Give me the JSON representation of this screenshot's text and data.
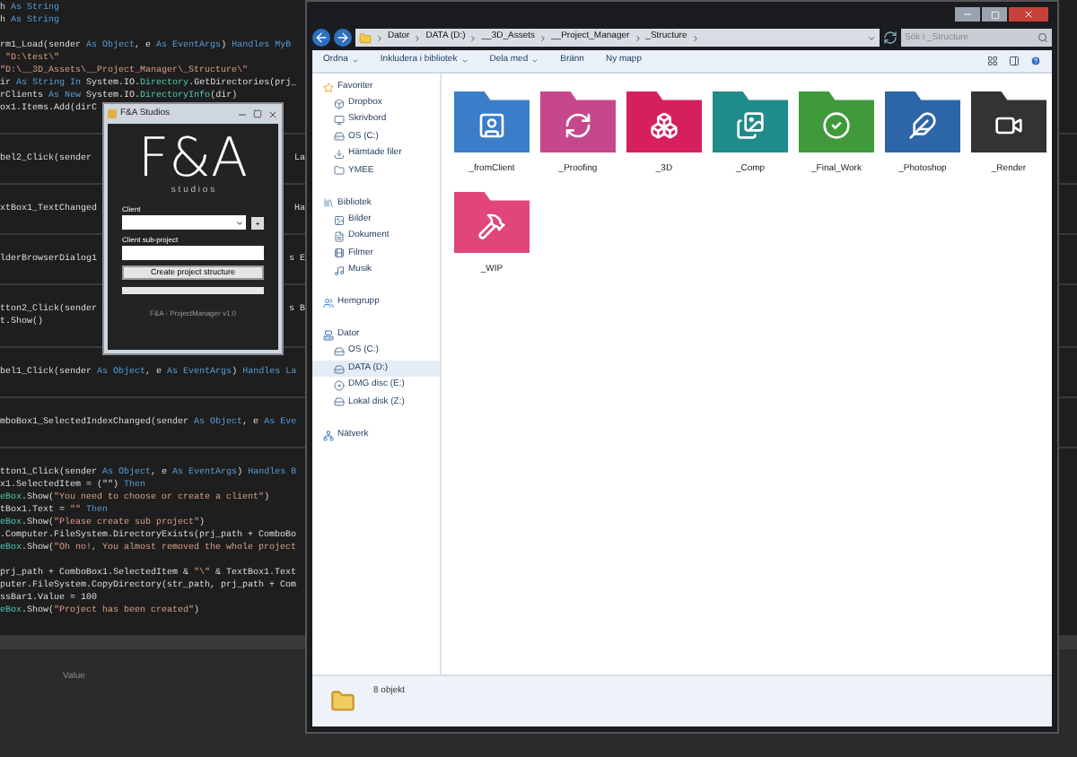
{
  "code_editor": {
    "blocks": [
      {
        "paragraphs": [
          [
            {
              "parts": [
                {
                  "text": "h ",
                  "kind": "plain"
                },
                {
                  "text": "As String",
                  "kind": "keyword"
                }
              ]
            },
            {
              "parts": [
                {
                  "text": "h ",
                  "kind": "plain"
                },
                {
                  "text": "As String",
                  "kind": "keyword"
                }
              ]
            }
          ],
          [
            {
              "parts": [
                {
                  "text": "rm1_Load(sender ",
                  "kind": "plain"
                },
                {
                  "text": "As Object",
                  "kind": "keyword"
                },
                {
                  "text": ", e ",
                  "kind": "plain"
                },
                {
                  "text": "As EventArgs",
                  "kind": "keyword"
                },
                {
                  "text": ") ",
                  "kind": "plain"
                },
                {
                  "text": "Handles MyB",
                  "kind": "keyword"
                }
              ]
            },
            {
              "parts": [
                {
                  "text": " \"D:\\test\\\"",
                  "kind": "string"
                }
              ]
            },
            {
              "parts": [
                {
                  "text": "\"D:\\__3D_Assets\\__Project_Manager\\_Structure\\\"",
                  "kind": "string"
                }
              ]
            },
            {
              "parts": [
                {
                  "text": "ir ",
                  "kind": "plain"
                },
                {
                  "text": "As String In ",
                  "kind": "keyword"
                },
                {
                  "text": "System.IO.",
                  "kind": "plain"
                },
                {
                  "text": "Directory",
                  "kind": "type"
                },
                {
                  "text": ".GetDirectories(prj_",
                  "kind": "plain"
                }
              ]
            },
            {
              "parts": [
                {
                  "text": "rClients ",
                  "kind": "plain"
                },
                {
                  "text": "As New ",
                  "kind": "keyword"
                },
                {
                  "text": "System.IO.",
                  "kind": "plain"
                },
                {
                  "text": "DirectoryInfo",
                  "kind": "type"
                },
                {
                  "text": "(dir)",
                  "kind": "plain"
                }
              ]
            },
            {
              "parts": [
                {
                  "text": "ox1.Items.Add(dirC",
                  "kind": "plain"
                }
              ]
            }
          ]
        ]
      },
      {
        "paragraphs": [
          [
            {
              "parts": [
                {
                  "text": "bel2_Click(sender",
                  "kind": "plain"
                }
              ],
              "right": "La"
            }
          ]
        ]
      },
      {
        "paragraphs": [
          [
            {
              "parts": [
                {
                  "text": "xtBox1_TextChanged",
                  "kind": "plain"
                }
              ],
              "right": "Ha"
            }
          ]
        ]
      },
      {
        "paragraphs": [
          [
            {
              "parts": [
                {
                  "text": "lderBrowserDialog1",
                  "kind": "plain"
                }
              ],
              "right": "s E"
            }
          ]
        ]
      },
      {
        "paragraphs": [
          [
            {
              "parts": [
                {
                  "text": "tton2_Click(sender",
                  "kind": "plain"
                }
              ],
              "right": "s B"
            },
            {
              "parts": [
                {
                  "text": "t.Show()",
                  "kind": "plain"
                }
              ]
            }
          ]
        ]
      },
      {
        "paragraphs": [
          [
            {
              "parts": [
                {
                  "text": "bel1_Click(sender ",
                  "kind": "plain"
                },
                {
                  "text": "As Object",
                  "kind": "keyword"
                },
                {
                  "text": ", e ",
                  "kind": "plain"
                },
                {
                  "text": "As EventArgs",
                  "kind": "keyword"
                },
                {
                  "text": ") ",
                  "kind": "plain"
                },
                {
                  "text": "Handles La",
                  "kind": "keyword"
                }
              ]
            }
          ]
        ]
      },
      {
        "paragraphs": [
          [
            {
              "parts": [
                {
                  "text": "mboBox1_SelectedIndexChanged(sender ",
                  "kind": "plain"
                },
                {
                  "text": "As Object",
                  "kind": "keyword"
                },
                {
                  "text": ", e ",
                  "kind": "plain"
                },
                {
                  "text": "As Eve",
                  "kind": "keyword"
                }
              ]
            }
          ]
        ]
      },
      {
        "paragraphs": [
          [
            {
              "parts": [
                {
                  "text": "tton1_Click(sender ",
                  "kind": "plain"
                },
                {
                  "text": "As Object",
                  "kind": "keyword"
                },
                {
                  "text": ", e ",
                  "kind": "plain"
                },
                {
                  "text": "As EventArgs",
                  "kind": "keyword"
                },
                {
                  "text": ") ",
                  "kind": "plain"
                },
                {
                  "text": "Handles B",
                  "kind": "keyword"
                }
              ]
            },
            {
              "parts": [
                {
                  "text": "x1.SelectedItem = (\"\") ",
                  "kind": "plain"
                },
                {
                  "text": "Then",
                  "kind": "keyword"
                }
              ]
            },
            {
              "parts": [
                {
                  "text": "eBox",
                  "kind": "type"
                },
                {
                  "text": ".Show(",
                  "kind": "plain"
                },
                {
                  "text": "\"You need to choose or create a client\"",
                  "kind": "string"
                },
                {
                  "text": ")",
                  "kind": "plain"
                }
              ]
            },
            {
              "parts": [
                {
                  "text": "tBox1.Text = ",
                  "kind": "plain"
                },
                {
                  "text": "\"\" ",
                  "kind": "string"
                },
                {
                  "text": "Then",
                  "kind": "keyword"
                }
              ]
            },
            {
              "parts": [
                {
                  "text": "eBox",
                  "kind": "type"
                },
                {
                  "text": ".Show(",
                  "kind": "plain"
                },
                {
                  "text": "\"Please create sub project\"",
                  "kind": "string"
                },
                {
                  "text": ")",
                  "kind": "plain"
                }
              ]
            },
            {
              "parts": [
                {
                  "text": ".Computer.FileSystem.DirectoryExists(prj_path + ComboBo",
                  "kind": "plain"
                }
              ]
            },
            {
              "parts": [
                {
                  "text": "eBox",
                  "kind": "type"
                },
                {
                  "text": ".Show(",
                  "kind": "plain"
                },
                {
                  "text": "\"Oh no!, You almost removed the whole project",
                  "kind": "string"
                }
              ]
            }
          ],
          [
            {
              "parts": [
                {
                  "text": "prj_path + ComboBox1.SelectedItem & ",
                  "kind": "plain"
                },
                {
                  "text": "\"\\\"",
                  "kind": "string"
                },
                {
                  "text": " & TextBox1.Text",
                  "kind": "plain"
                }
              ]
            },
            {
              "parts": [
                {
                  "text": "puter.FileSystem.CopyDirectory(str_path, prj_path + Com",
                  "kind": "plain"
                }
              ]
            },
            {
              "parts": [
                {
                  "text": "ssBar1.Value = 100",
                  "kind": "plain"
                }
              ]
            },
            {
              "parts": [
                {
                  "text": "eBox",
                  "kind": "type"
                },
                {
                  "text": ".Show(",
                  "kind": "plain"
                },
                {
                  "text": "\"Project has been created\"",
                  "kind": "string"
                },
                {
                  "text": ")",
                  "kind": "plain"
                }
              ]
            }
          ]
        ]
      }
    ],
    "properties_label": "Value"
  },
  "dialog": {
    "title": "F&A Studios",
    "logo": "F&A",
    "logo_sub": "s t u d i o s",
    "client_label": "Client",
    "add_button": "+",
    "sub_project_label": "Client sub-project",
    "create_button": "Create project structure",
    "progress": {
      "level": 0
    },
    "version": "F&A - ProjectManager v1.0"
  },
  "explorer": {
    "breadcrumb": [
      "Dator",
      "DATA (D:)",
      "__3D_Assets",
      "__Project_Manager",
      "_Structure"
    ],
    "search": {
      "placeholder": "Sök i _Structure"
    },
    "toolbar": [
      {
        "label": "Ordna",
        "has_menu": true
      },
      {
        "label": "Inkludera i bibliotek",
        "has_menu": true
      },
      {
        "label": "Dela med",
        "has_menu": true
      },
      {
        "label": "Bränn",
        "has_menu": false
      },
      {
        "label": "Ny mapp",
        "has_menu": false
      }
    ],
    "nav": [
      {
        "label": "Favoriter",
        "children": [
          {
            "label": "Dropbox",
            "selected": false
          },
          {
            "label": "Skrivbord",
            "selected": false
          },
          {
            "label": "OS (C:)",
            "selected": false
          },
          {
            "label": "Hämtade filer",
            "selected": false
          },
          {
            "label": "YMEE",
            "selected": false
          }
        ]
      },
      {
        "label": "Bibliotek",
        "children": [
          {
            "label": "Bilder",
            "selected": false
          },
          {
            "label": "Dokument",
            "selected": false
          },
          {
            "label": "Filmer",
            "selected": false
          },
          {
            "label": "Musik",
            "selected": false
          }
        ]
      },
      {
        "label": "Hemgrupp"
      },
      {
        "label": "Dator",
        "children": [
          {
            "label": "OS (C:)",
            "selected": false
          },
          {
            "label": "DATA (D:)",
            "selected": true
          },
          {
            "label": "DMG disc (E:)",
            "selected": false
          },
          {
            "label": "Lokal disk (Z:)",
            "selected": false
          }
        ]
      },
      {
        "label": "Nätverk"
      }
    ],
    "folders": [
      {
        "name": "_fromClient",
        "color": "#3b7dc8"
      },
      {
        "name": "_Proofing",
        "color": "#c6488c"
      },
      {
        "name": "_3D",
        "color": "#d6205e"
      },
      {
        "name": "_Comp",
        "color": "#1f8b8a"
      },
      {
        "name": "_Final_Work",
        "color": "#409a3b"
      },
      {
        "name": "_Photoshop",
        "color": "#2d65a9"
      },
      {
        "name": "_Render",
        "color": "#333333"
      },
      {
        "name": "_WIP",
        "color": "#e0457b"
      }
    ],
    "status": "8 objekt"
  }
}
